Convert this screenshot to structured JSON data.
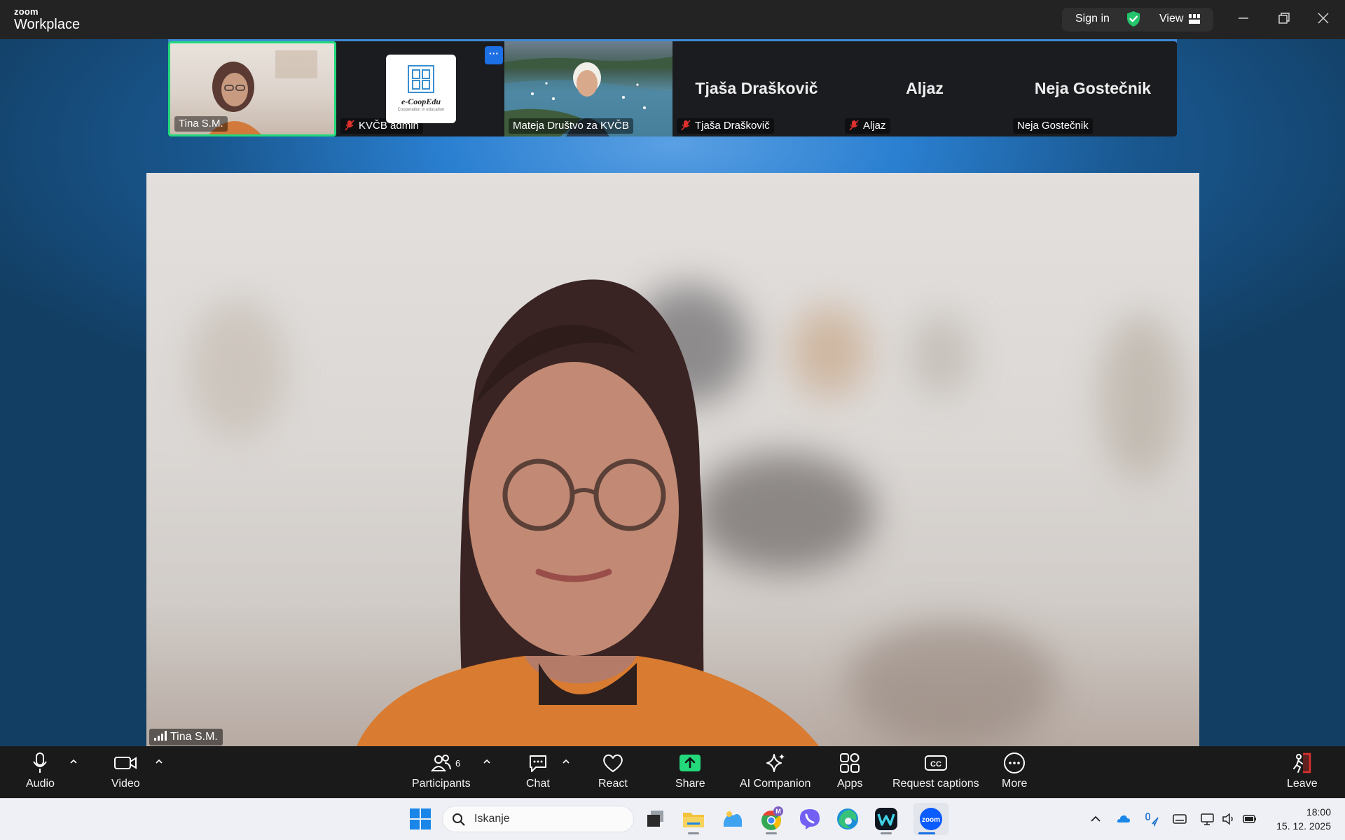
{
  "app": {
    "brand_small": "zoom",
    "brand_big": "Workplace"
  },
  "titlebar": {
    "sign_in": "Sign in",
    "view": "View"
  },
  "colors": {
    "speaking_border": "#23d97b",
    "accent": "#1d6fe4",
    "mic_off": "#e0312e",
    "share": "#23d97b",
    "leave": "#e0312e"
  },
  "gallery": [
    {
      "name": "Tina S.M.",
      "muted": false,
      "video": "camera"
    },
    {
      "name": "KVČB admin",
      "muted": true,
      "video": "logo",
      "logo_text": "e-CoopEdu",
      "logo_sub": "Cooperation in education"
    },
    {
      "name": "Mateja Društvo za KVČB",
      "muted": false,
      "video": "camera"
    },
    {
      "name": "Tjaša Draškovič",
      "center_name": "Tjaša Draškovič",
      "muted": true,
      "video": "off"
    },
    {
      "name": "Aljaz",
      "center_name": "Aljaz",
      "muted": true,
      "video": "off"
    },
    {
      "name": "Neja Gostečnik",
      "center_name": "Neja Gostečnik",
      "muted": false,
      "video": "off"
    }
  ],
  "main_video": {
    "name": "Tina S.M."
  },
  "toolbar": {
    "audio": "Audio",
    "video": "Video",
    "participants": "Participants",
    "participants_count": "6",
    "chat": "Chat",
    "react": "React",
    "share": "Share",
    "ai_companion": "AI Companion",
    "apps": "Apps",
    "captions": "Request captions",
    "captions_icon_text": "CC",
    "more": "More",
    "leave": "Leave"
  },
  "taskbar": {
    "search_placeholder": "Iskanje",
    "chrome_badge": "M",
    "zoom_app_text": "zoom",
    "time": "18:00",
    "date": "15. 12. 2025"
  }
}
